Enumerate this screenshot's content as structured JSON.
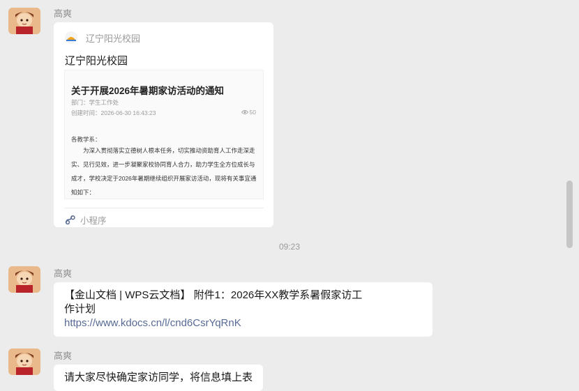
{
  "messages": [
    {
      "sender": "高爽",
      "type": "mini_program",
      "source_name": "辽宁阳光校园",
      "card_title": "辽宁阳光校园",
      "preview": {
        "title": "关于开展2026年暑期家访活动的通知",
        "department": "部门：学生工作处",
        "created": "创建时间：2026-06-30 16:43:23",
        "views": "50",
        "salutation": "各教学系：",
        "body": "为深入贯彻落实立德树人根本任务，切实推动资助育人工作走深走实、见行见效，进一步凝聚家校协同育人合力，助力学生全方位成长与成才，学校决定于2026年暑期继续组织开展家访活动，现将有关事宜通知如下："
      },
      "footer_label": "小程序"
    },
    {
      "timestamp": "09:23"
    },
    {
      "sender": "高爽",
      "type": "link_text",
      "line1": "【金山文档 | WPS云文档】 附件1：2026年XX教学系暑假家访工",
      "line2": "作计划",
      "url": "https://www.kdocs.cn/l/cnd6CsrYqRnK"
    },
    {
      "sender": "高爽",
      "type": "text",
      "text": "请大家尽快确定家访同学，将信息填上表"
    }
  ],
  "colors": {
    "background": "#ececec",
    "bubble": "#ffffff",
    "link": "#576b95",
    "meta_text": "#9a9a9a"
  },
  "icons": {
    "avatar": "cartoon-avatar",
    "source_logo": "sun-logo-icon",
    "mini_program": "mini-program-icon",
    "views": "eye-icon"
  }
}
